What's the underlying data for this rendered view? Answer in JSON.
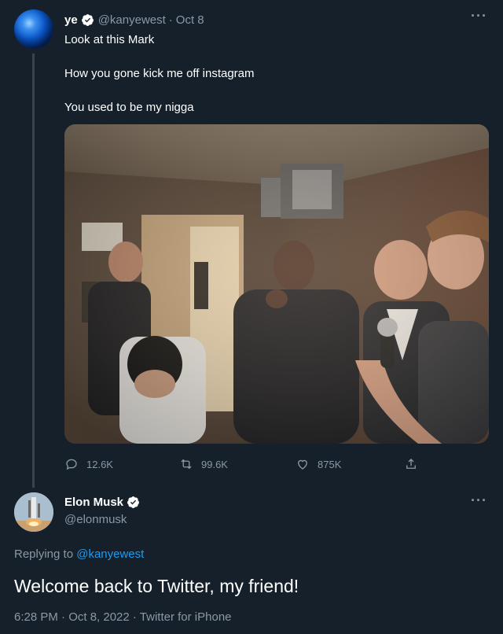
{
  "original_tweet": {
    "name": "ye",
    "handle": "@kanyewest",
    "separator": "·",
    "date": "Oct 8",
    "more_label": "···",
    "text_lines": [
      "Look at this Mark",
      "How you gone kick me off instagram",
      "You used to be my nigga"
    ],
    "stats": {
      "replies": "12.6K",
      "retweets": "99.6K",
      "likes": "875K"
    }
  },
  "reply_tweet": {
    "name": "Elon Musk",
    "handle": "@elonmusk",
    "more_label": "···",
    "replying_prefix": "Replying to",
    "replying_to": "@kanyewest",
    "text": "Welcome back to Twitter, my friend!",
    "meta": "6:28 PM · Oct 8, 2022 · Twitter for iPhone"
  },
  "colors": {
    "background": "#15202b",
    "secondary_text": "#8b98a5",
    "link": "#1d9bf0",
    "verified_badge": "#ffffff"
  },
  "icons": [
    "verified-icon",
    "more-icon",
    "reply-icon",
    "retweet-icon",
    "like-icon",
    "share-icon"
  ]
}
